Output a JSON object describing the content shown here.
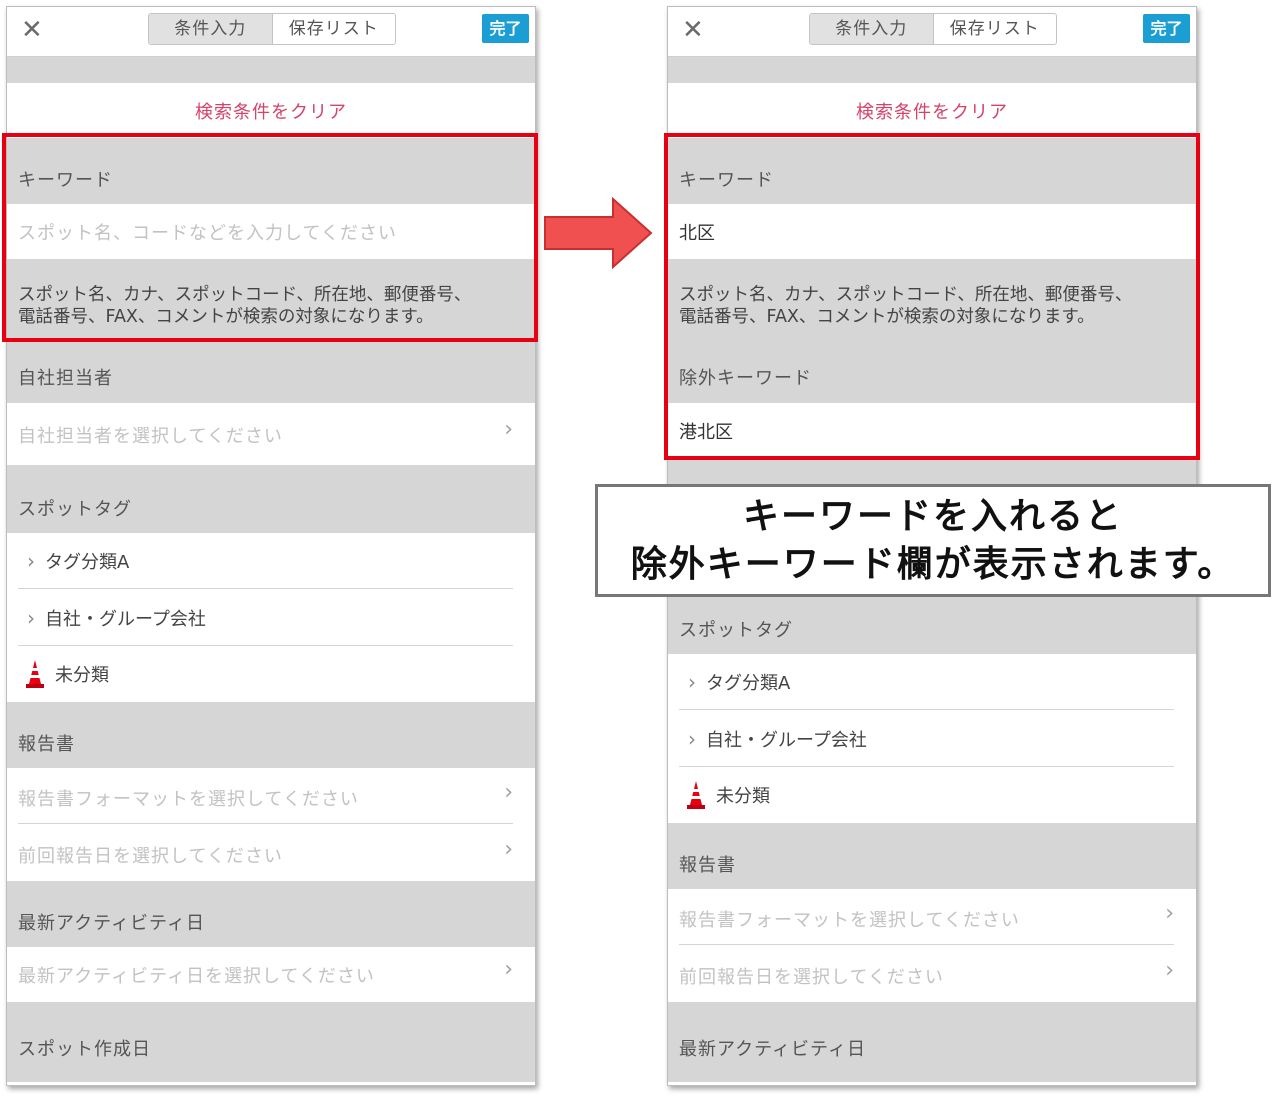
{
  "topbar": {
    "tab_input": "条件入力",
    "tab_saved": "保存リスト",
    "done_label": "完了",
    "close_glyph": "✕"
  },
  "clear_link": "検索条件をクリア",
  "keyword": {
    "title": "キーワード",
    "placeholder": "スポット名、コードなどを入力してください",
    "value": "北区",
    "desc_line1": "スポット名、カナ、スポットコード、所在地、郵便番号、",
    "desc_line2": "電話番号、FAX、コメントが検索の対象になります。"
  },
  "exclude": {
    "title": "除外キーワード",
    "value": "港北区"
  },
  "staff": {
    "title": "自社担当者",
    "placeholder": "自社担当者を選択してください"
  },
  "spot_tag": {
    "title": "スポットタグ",
    "items": [
      "タグ分類A",
      "自社・グループ会社",
      "未分類"
    ]
  },
  "report": {
    "title": "報告書",
    "format_placeholder": "報告書フォーマットを選択してください",
    "last_date_placeholder": "前回報告日を選択してください"
  },
  "activity": {
    "title": "最新アクティビティ日",
    "placeholder": "最新アクティビティ日を選択してください"
  },
  "created": {
    "title": "スポット作成日"
  },
  "chevron": "›",
  "callout": {
    "line1": "キーワードを入れると",
    "line2": "除外キーワード欄が表示されます。"
  },
  "colors": {
    "highlight": "#e60012",
    "done": "#1b9ed3",
    "clear": "#d5436a",
    "arrow": "#f05050"
  }
}
